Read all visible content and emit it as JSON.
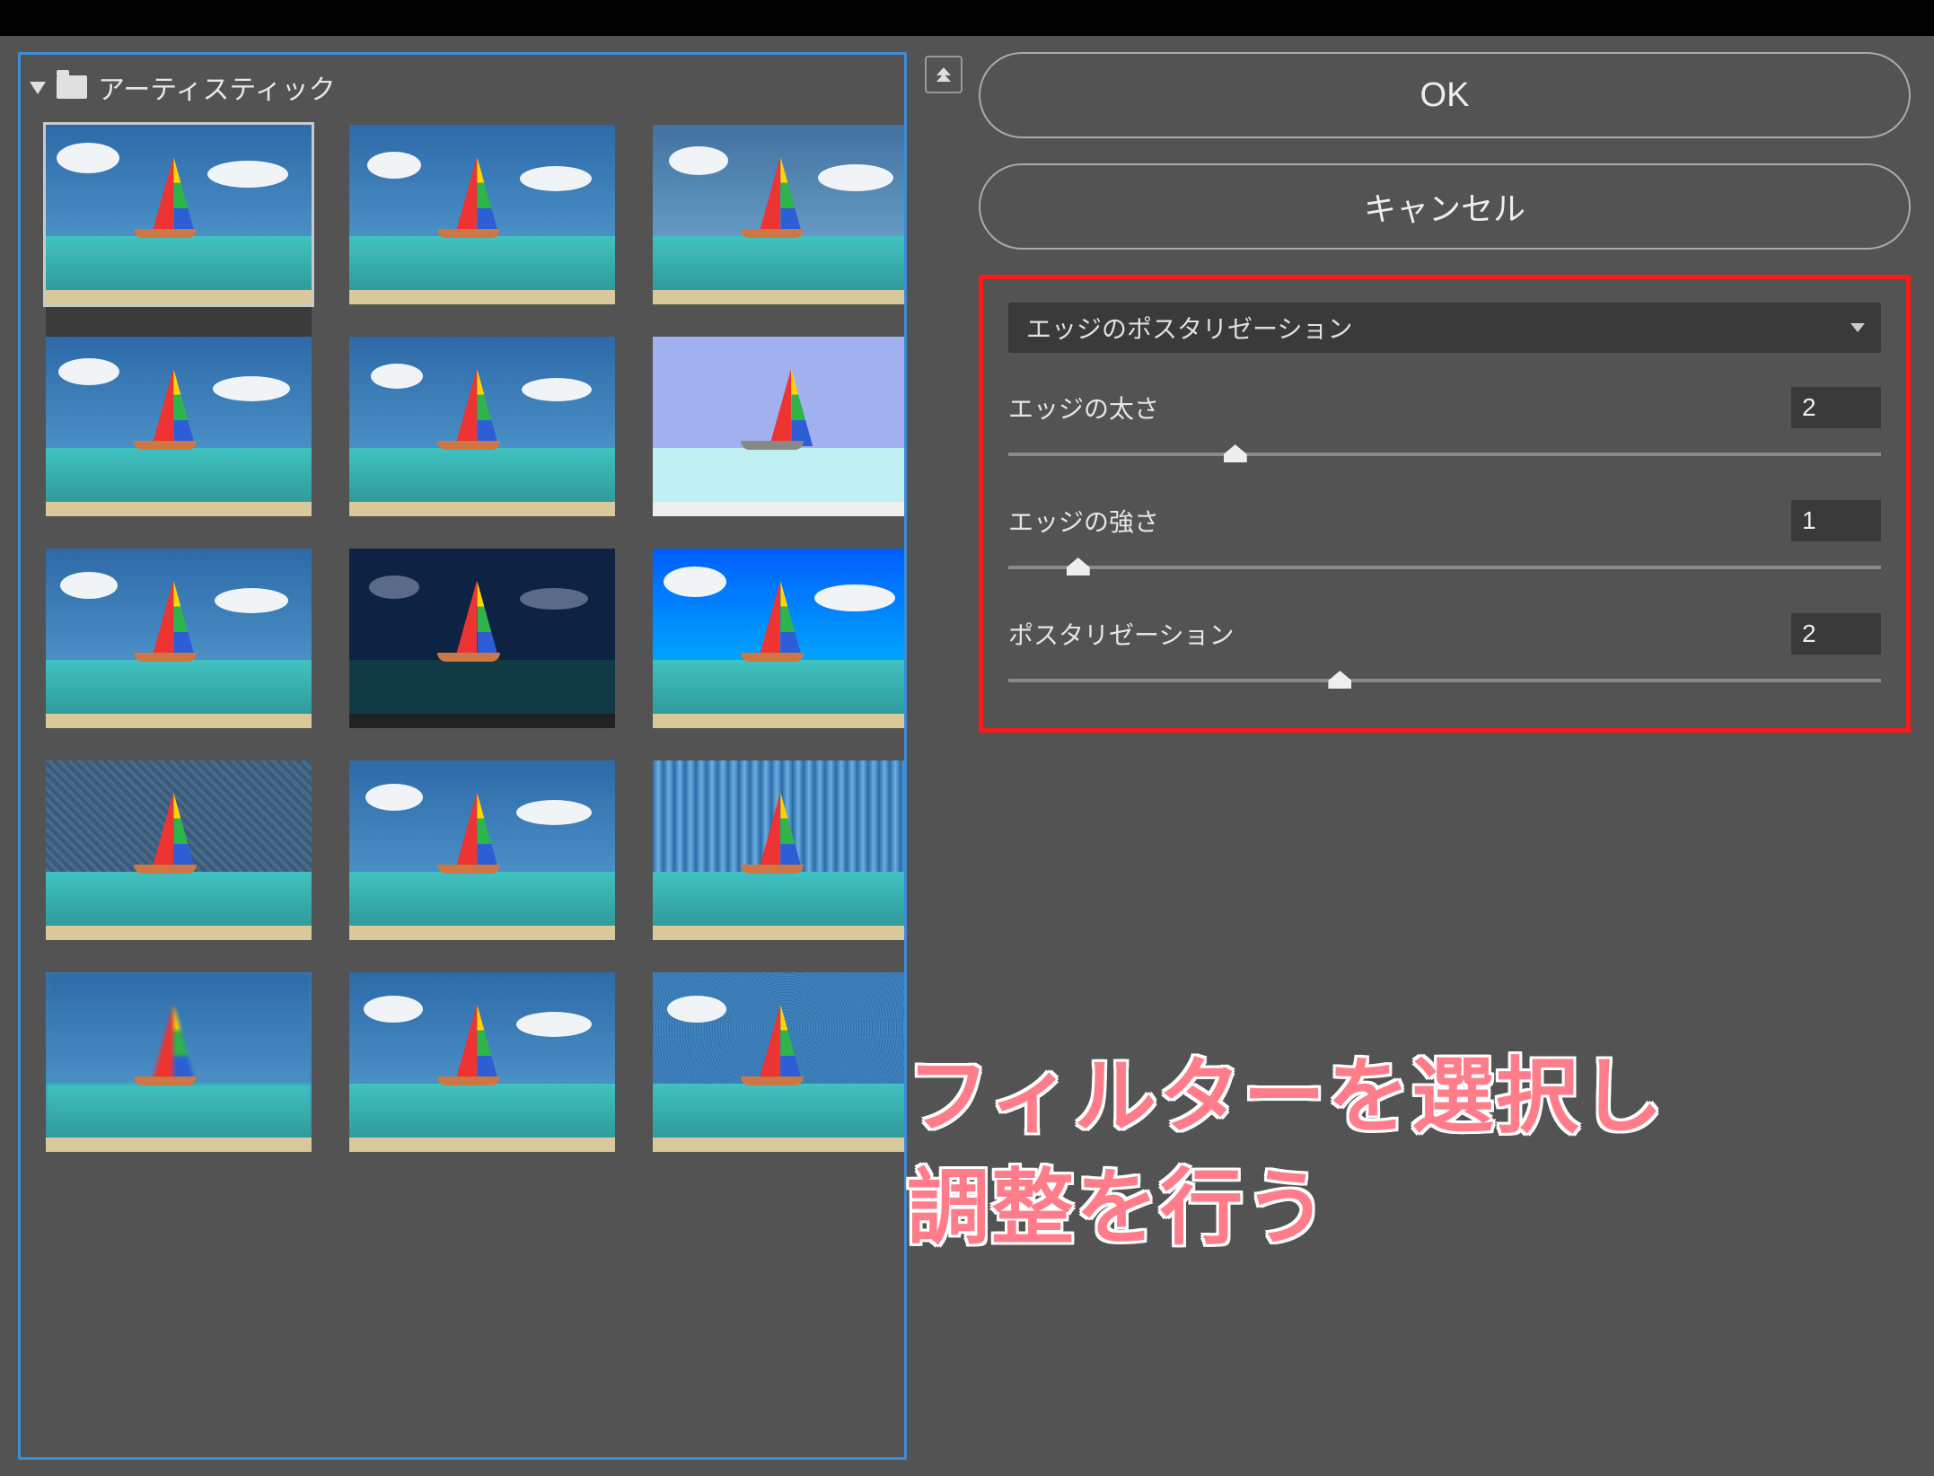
{
  "gallery": {
    "category_label": "アーティスティック",
    "selected_index": 0,
    "thumbnails": [
      {
        "id": 0
      },
      {
        "id": 1
      },
      {
        "id": 2
      },
      {
        "id": 3
      },
      {
        "id": 4
      },
      {
        "id": 5
      },
      {
        "id": 6
      },
      {
        "id": 7
      },
      {
        "id": 8
      },
      {
        "id": 9
      },
      {
        "id": 10
      },
      {
        "id": 11
      },
      {
        "id": 12
      },
      {
        "id": 13
      },
      {
        "id": 14
      }
    ]
  },
  "buttons": {
    "ok": "OK",
    "cancel": "キャンセル"
  },
  "filter": {
    "dropdown_label": "エッジのポスタリゼーション",
    "params": [
      {
        "label": "エッジの太さ",
        "value": "2",
        "pos_pct": 26
      },
      {
        "label": "エッジの強さ",
        "value": "1",
        "pos_pct": 8
      },
      {
        "label": "ポスタリゼーション",
        "value": "2",
        "pos_pct": 38
      }
    ]
  },
  "annotation": {
    "text": "フィルターを選択し\n調整を行う"
  }
}
